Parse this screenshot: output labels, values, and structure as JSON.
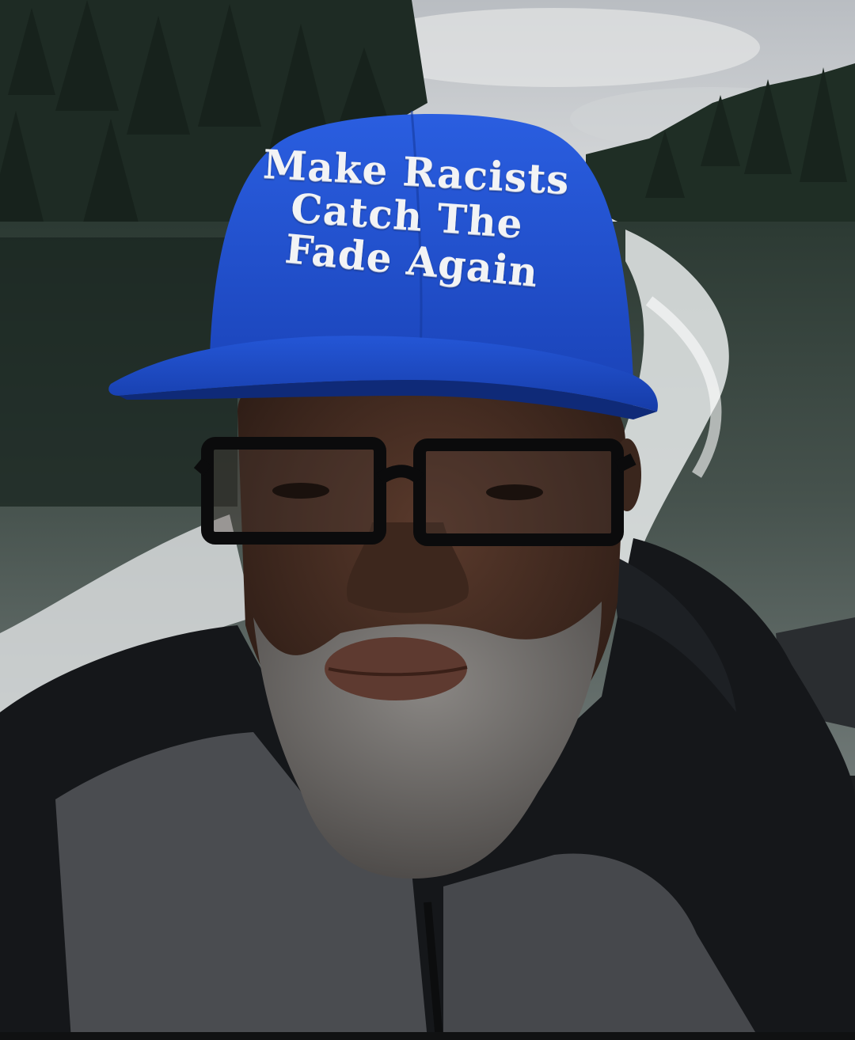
{
  "cap_slogan": {
    "lines": [
      "Make Racists",
      "Catch The",
      "Fade Again"
    ]
  },
  "colors": {
    "cap_blue": "#1f4fd0",
    "sky": "#c9ccd0",
    "forest": "#1f2f26",
    "water": "#5c6662",
    "wake": "#e6e9ea",
    "hoodie_black": "#15171a",
    "sweater_grey": "#4a4c50"
  }
}
